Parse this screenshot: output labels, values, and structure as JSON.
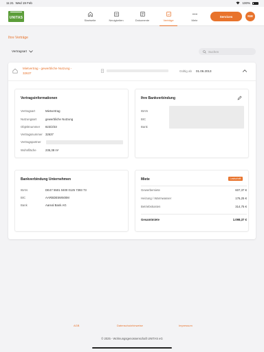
{
  "status_bar": {
    "time": "11:21",
    "date": "Wed 19 Feb",
    "battery": "100%"
  },
  "logo": {
    "text": "UNITAS"
  },
  "nav": {
    "items": [
      {
        "label": "Startseite",
        "icon": "home-icon"
      },
      {
        "label": "Neuigkeiten",
        "icon": "news-icon"
      },
      {
        "label": "Dokumente",
        "icon": "document-icon"
      },
      {
        "label": "Verträge",
        "icon": "contract-icon",
        "active": true
      },
      {
        "label": "Mehr",
        "icon": "more-icon"
      }
    ],
    "services_label": "Services",
    "avatar_initials": "NW"
  },
  "page": {
    "title": "Ihre Verträge",
    "filter_label": "Vertragsart",
    "search_placeholder": "Suchen"
  },
  "contract": {
    "name": "Mietvertrag - gewerbliche Nutzung - 32637",
    "valid_label": "Gültig ab",
    "valid_date": "01.06.2013"
  },
  "vertragsinfo": {
    "title": "Vertragsinformationen",
    "rows": [
      {
        "label": "Vertragsart",
        "value": "Mietvertrag"
      },
      {
        "label": "Nutzungsart",
        "value": "gewerbliche Nutzung"
      },
      {
        "label": "Objektnummer",
        "value": "823/2/33"
      },
      {
        "label": "Vertragsnummer",
        "value": "32637"
      },
      {
        "label": "Vertragspartner",
        "value": ""
      },
      {
        "label": "Wohnfläche",
        "value": "235,38 m²"
      }
    ]
  },
  "bankverbindung": {
    "title": "Ihre Bankverbindung",
    "rows": [
      {
        "label": "IBAN"
      },
      {
        "label": "BIC"
      },
      {
        "label": "Bank"
      }
    ]
  },
  "bank_unternehmen": {
    "title": "Bankverbindung Unternehmen",
    "rows": [
      {
        "label": "IBAN",
        "value": "DE47 5501 0400 0125 7393 73"
      },
      {
        "label": "BIC",
        "value": "AARBDE5W500M"
      },
      {
        "label": "Bank",
        "value": "Aareal Bank AG"
      }
    ]
  },
  "miete": {
    "title": "Miete",
    "badge": "Lastschrift",
    "rows": [
      {
        "label": "Gewerbemiete",
        "value": "607,37 €"
      },
      {
        "label": "Heizung / Warmwasser",
        "value": "176,25 €"
      },
      {
        "label": "Betriebskosten",
        "value": "314,75 €"
      }
    ],
    "total_label": "Gesamtmiete",
    "total_value": "1.098,37 €"
  },
  "footer": {
    "links": [
      "AGB",
      "Datenschutzhinweise",
      "Impressum"
    ],
    "copyright": "© 2025 - Wohnungsgenossenschaft UNITAS eG"
  },
  "colors": {
    "accent": "#e8732c",
    "logo": "#5c9e3a"
  }
}
